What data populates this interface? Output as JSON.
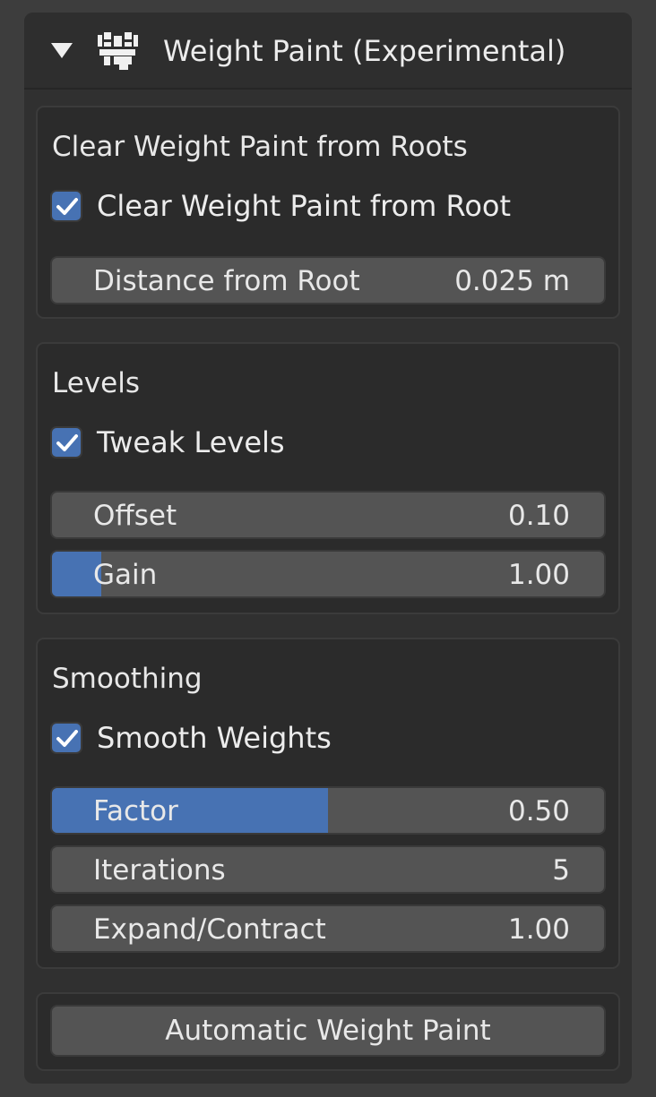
{
  "panel": {
    "title": "Weight Paint (Experimental)",
    "collapse_icon": "triangle-down-icon",
    "header_icon": "weight-paint-icon"
  },
  "clear_roots": {
    "title": "Clear Weight Paint from Roots",
    "checkbox": {
      "label": "Clear Weight Paint from Root",
      "checked": true
    },
    "distance": {
      "label": "Distance from Root",
      "value": "0.025 m"
    }
  },
  "levels": {
    "title": "Levels",
    "checkbox": {
      "label": "Tweak Levels",
      "checked": true
    },
    "offset": {
      "label": "Offset",
      "value": "0.10",
      "fill_fraction": 0
    },
    "gain": {
      "label": "Gain",
      "value": "1.00",
      "fill_fraction": 0.09
    }
  },
  "smoothing": {
    "title": "Smoothing",
    "checkbox": {
      "label": "Smooth Weights",
      "checked": true
    },
    "factor": {
      "label": "Factor",
      "value": "0.50",
      "fill_fraction": 0.5
    },
    "iterations": {
      "label": "Iterations",
      "value": "5"
    },
    "expand_contract": {
      "label": "Expand/Contract",
      "value": "1.00"
    }
  },
  "actions": {
    "auto_weight_paint": "Automatic Weight Paint"
  },
  "colors": {
    "accent": "#4772b3",
    "field_bg": "#545454",
    "panel_bg": "#303030",
    "box_bg": "#2b2b2b",
    "background": "#3d3d3d"
  }
}
